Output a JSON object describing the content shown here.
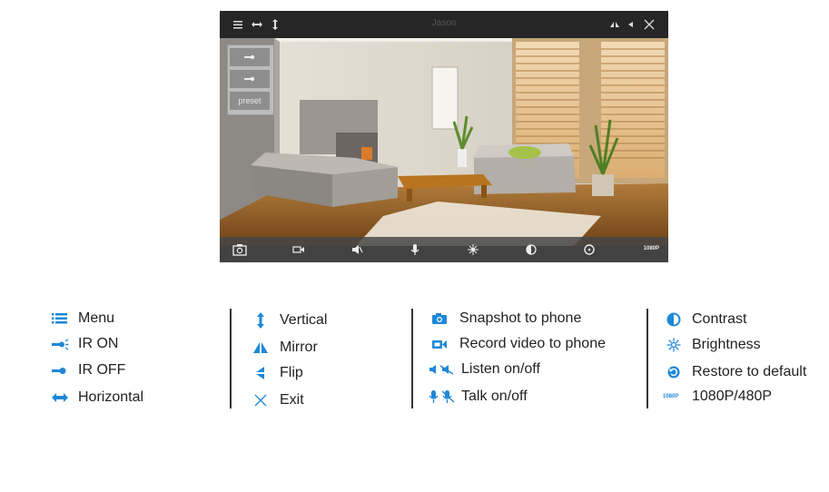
{
  "app": {
    "title": "Jason",
    "preset": {
      "label": "preset"
    },
    "resolution_label": "1080P"
  },
  "legend": {
    "col1": {
      "menu": "Menu",
      "ir_on": "IR ON",
      "ir_off": "IR OFF",
      "horizontal": "Horizontal"
    },
    "col2": {
      "vertical": "Vertical",
      "mirror": "Mirror",
      "flip": "Flip",
      "exit": "Exit"
    },
    "col3": {
      "snapshot": "Snapshot to phone",
      "record": "Record video to phone",
      "listen": "Listen on/off",
      "talk": "Talk on/off"
    },
    "col4": {
      "contrast": "Contrast",
      "brightness": "Brightness",
      "restore": "Restore to default",
      "resolution": "1080P/480P",
      "resolution_icon_text": "1080P"
    }
  },
  "colors": {
    "accent": "#1e88d8",
    "dark_bar": "#262626"
  }
}
